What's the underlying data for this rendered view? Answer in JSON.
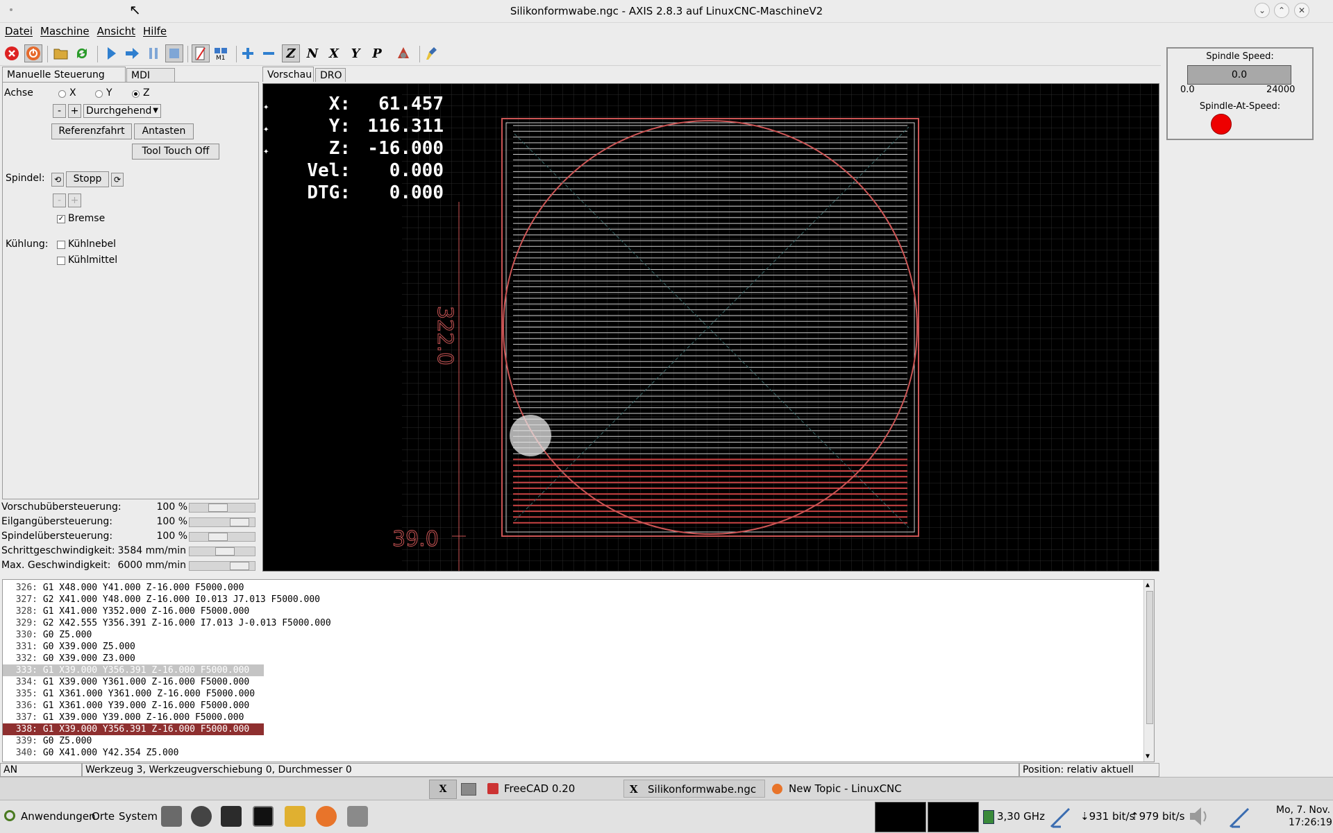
{
  "window": {
    "title": "Silikonformwabe.ngc - AXIS 2.8.3 auf LinuxCNC-MaschineV2",
    "buttons": [
      "minimize",
      "maximize",
      "close"
    ]
  },
  "menu": [
    "Datei",
    "Maschine",
    "Ansicht",
    "Hilfe"
  ],
  "toolbar": {
    "icons": [
      "estop-icon",
      "machine-power-icon",
      "open-file-icon",
      "reload-icon",
      "run-icon",
      "step-icon",
      "pause-icon",
      "stop-icon",
      "block-delete-icon",
      "optional-stop-icon",
      "zoom-in-icon",
      "zoom-out-icon",
      "view-z-icon",
      "view-z2-icon",
      "view-x-icon",
      "view-y-icon",
      "view-p-icon",
      "rotate-view-icon",
      "clear-plot-icon"
    ]
  },
  "left_tabs": [
    "Manuelle Steuerung [F3]",
    "MDI [F5]"
  ],
  "manual": {
    "axis_label": "Achse",
    "axes": [
      "X",
      "Y",
      "Z"
    ],
    "selected_axis": "Z",
    "minus": "-",
    "plus": "+",
    "jog_mode": "Durchgehend",
    "home_button": "Referenzfahrt",
    "touch_button": "Antasten",
    "tool_touch_off": "Tool Touch Off",
    "spindle_label": "Spindel:",
    "spindle_stop": "Stopp",
    "brake_label": "Bremse",
    "brake_checked": true,
    "cooling_label": "Kühlung:",
    "mist_label": "Kühlnebel",
    "flood_label": "Kühlmittel"
  },
  "overrides": [
    {
      "label": "Vorschubübersteuerung:",
      "value": "100 %",
      "level": 0.4
    },
    {
      "label": "Eilgangübersteuerung:",
      "value": "100 %",
      "level": 0.85
    },
    {
      "label": "Spindelübersteuerung:",
      "value": "100 %",
      "level": 0.4
    },
    {
      "label": "Schrittgeschwindigkeit:",
      "value": "3584 mm/min",
      "level": 0.55
    },
    {
      "label": "Max. Geschwindigkeit:",
      "value": "6000 mm/min",
      "level": 0.85
    }
  ],
  "preview_tabs": [
    "Vorschau",
    "DRO"
  ],
  "dro": [
    {
      "label": "X:",
      "value": "61.457"
    },
    {
      "label": "Y:",
      "value": "116.311"
    },
    {
      "label": "Z:",
      "value": "-16.000"
    },
    {
      "label": "Vel:",
      "value": "0.000"
    },
    {
      "label": "DTG:",
      "value": "0.000"
    }
  ],
  "dimensions": {
    "height": "322.0",
    "offset": "39.0"
  },
  "gcode": [
    {
      "n": "326:",
      "t": "G1 X48.000 Y41.000 Z-16.000 F5000.000",
      "s": ""
    },
    {
      "n": "327:",
      "t": "G2 X41.000 Y48.000 Z-16.000 I0.013 J7.013 F5000.000",
      "s": ""
    },
    {
      "n": "328:",
      "t": "G1 X41.000 Y352.000 Z-16.000 F5000.000",
      "s": ""
    },
    {
      "n": "329:",
      "t": "G2 X42.555 Y356.391 Z-16.000 I7.013 J-0.013 F5000.000",
      "s": ""
    },
    {
      "n": "330:",
      "t": "G0 Z5.000",
      "s": ""
    },
    {
      "n": "331:",
      "t": "G0 X39.000 Z5.000",
      "s": ""
    },
    {
      "n": "332:",
      "t": "G0 X39.000 Z3.000",
      "s": ""
    },
    {
      "n": "333:",
      "t": "G1 X39.000 Y356.391 Z-16.000 F5000.000",
      "s": "cur"
    },
    {
      "n": "334:",
      "t": "G1 X39.000 Y361.000 Z-16.000 F5000.000",
      "s": ""
    },
    {
      "n": "335:",
      "t": "G1 X361.000 Y361.000 Z-16.000 F5000.000",
      "s": ""
    },
    {
      "n": "336:",
      "t": "G1 X361.000 Y39.000 Z-16.000 F5000.000",
      "s": ""
    },
    {
      "n": "337:",
      "t": "G1 X39.000 Y39.000 Z-16.000 F5000.000",
      "s": ""
    },
    {
      "n": "338:",
      "t": "G1 X39.000 Y356.391 Z-16.000 F5000.000",
      "s": "act"
    },
    {
      "n": "339:",
      "t": "G0 Z5.000",
      "s": ""
    },
    {
      "n": "340:",
      "t": "G0 X41.000 Y42.354 Z5.000",
      "s": ""
    }
  ],
  "status": {
    "state": "AN",
    "tool": "Werkzeug 3, Werkzeugverschiebung 0, Durchmesser 0",
    "position": "Position: relativ aktuell"
  },
  "spindle_panel": {
    "speed_label": "Spindle Speed:",
    "speed_value": "0.0",
    "min": "0.0",
    "max": "24000",
    "at_speed_label": "Spindle-At-Speed:",
    "at_speed_color": "#ee0000"
  },
  "taskbar_windows": [
    "FreeCAD 0.20",
    "Silikonformwabe.ngc",
    "New Topic - LinuxCNC ..."
  ],
  "panel": {
    "menus": [
      "Anwendungen",
      "Orte",
      "System"
    ],
    "cpu": "3,30 GHz",
    "net_down": "931 bit/s",
    "net_up": "979 bit/s",
    "date": "Mo, 7. Nov.",
    "time": "17:26:19"
  }
}
